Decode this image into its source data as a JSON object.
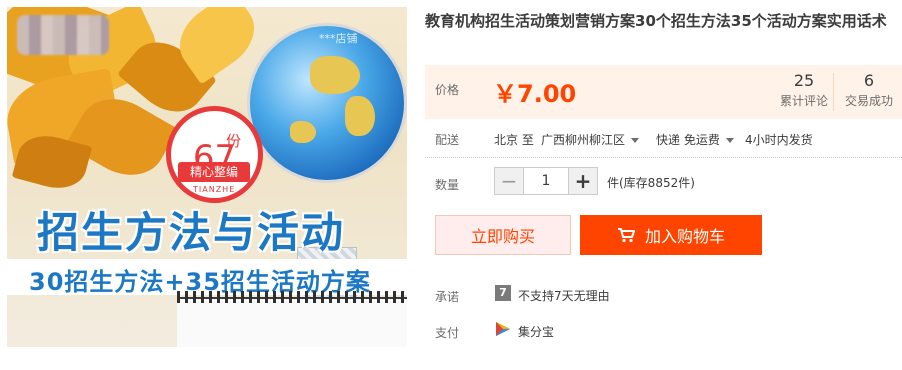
{
  "product": {
    "title": "教育机构招生活动策划营销方案30个招生方法35个活动方案实用话术",
    "image": {
      "badge_number": "67",
      "badge_unit": "份",
      "badge_strip": "精心整编",
      "badge_pinyin": "TIANZHE",
      "headline": "招生方法与活动",
      "subline": "30招生方法+35招生活动方案",
      "faint_watermark": "***店铺"
    }
  },
  "price": {
    "label": "价格",
    "value": "￥7.00"
  },
  "stats": {
    "reviews_count": "25",
    "reviews_label": "累计评论",
    "trades_count": "6",
    "trades_label": "交易成功"
  },
  "delivery": {
    "label": "配送",
    "from": "北京 至",
    "to": "广西柳州柳江区",
    "shipping": "快递 免运费",
    "dispatch": "4小时内发货"
  },
  "quantity": {
    "label": "数量",
    "minus": "−",
    "plus": "+",
    "value": "1",
    "stock": "件(库存8852件)"
  },
  "actions": {
    "buy_now": "立即购买",
    "add_to_cart": "加入购物车"
  },
  "promise": {
    "label": "承诺",
    "icon_char": "7",
    "text": "不支持7天无理由"
  },
  "payment": {
    "label": "支付",
    "text": "集分宝"
  },
  "colors": {
    "accent": "#ff4400",
    "price_bg": "#fff2e8",
    "buy_now_bg": "#ffeded",
    "image_blue": "#1c78c4",
    "badge_red": "#e83a3a"
  }
}
